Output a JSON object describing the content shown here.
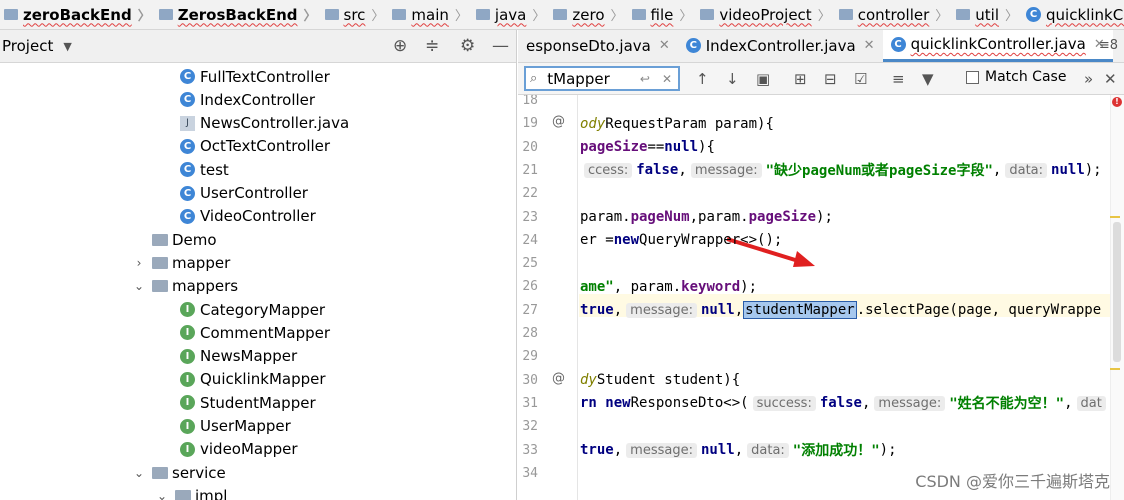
{
  "breadcrumb": [
    {
      "label": "zeroBackEnd",
      "icon": "folder-icon",
      "bold": true
    },
    {
      "label": "ZerosBackEnd",
      "icon": "folder-icon",
      "bold": true
    },
    {
      "label": "src",
      "icon": "folder-icon"
    },
    {
      "label": "main",
      "icon": "folder-icon"
    },
    {
      "label": "java",
      "icon": "folder-icon"
    },
    {
      "label": "zero",
      "icon": "folder-icon"
    },
    {
      "label": "file",
      "icon": "folder-icon"
    },
    {
      "label": "videoProject",
      "icon": "folder-icon"
    },
    {
      "label": "controller",
      "icon": "folder-icon"
    },
    {
      "label": "util",
      "icon": "folder-icon"
    },
    {
      "label": "quicklinkController",
      "icon": "class-icon"
    }
  ],
  "project": {
    "title": "Project",
    "tree": [
      {
        "label": "FullTextController",
        "icon": "class-icon",
        "indent": 2
      },
      {
        "label": "IndexController",
        "icon": "class-icon",
        "indent": 2
      },
      {
        "label": "NewsController.java",
        "icon": "java-file-icon",
        "indent": 2
      },
      {
        "label": "OctTextController",
        "icon": "class-icon",
        "indent": 2
      },
      {
        "label": "test",
        "icon": "class-icon",
        "indent": 2
      },
      {
        "label": "UserController",
        "icon": "class-icon",
        "indent": 2
      },
      {
        "label": "VideoController",
        "icon": "class-icon",
        "indent": 2
      },
      {
        "label": "Demo",
        "icon": "package-icon",
        "indent": 1,
        "arrow": ""
      },
      {
        "label": "mapper",
        "icon": "package-icon",
        "indent": 1,
        "arrow": "›"
      },
      {
        "label": "mappers",
        "icon": "package-icon",
        "indent": 1,
        "arrow": "⌄"
      },
      {
        "label": "CategoryMapper",
        "icon": "interface-icon",
        "indent": 2
      },
      {
        "label": "CommentMapper",
        "icon": "interface-icon",
        "indent": 2
      },
      {
        "label": "NewsMapper",
        "icon": "interface-icon",
        "indent": 2
      },
      {
        "label": "QuicklinkMapper",
        "icon": "interface-icon",
        "indent": 2
      },
      {
        "label": "StudentMapper",
        "icon": "interface-icon",
        "indent": 2
      },
      {
        "label": "UserMapper",
        "icon": "interface-icon",
        "indent": 2
      },
      {
        "label": "videoMapper",
        "icon": "interface-icon",
        "indent": 2
      },
      {
        "label": "service",
        "icon": "package-icon",
        "indent": 1,
        "arrow": "⌄"
      },
      {
        "label": "impl",
        "icon": "package-icon",
        "indent": 2,
        "arrow": "⌄"
      }
    ]
  },
  "tabs": [
    {
      "label": "esponseDto.java",
      "icon": "java-file-icon",
      "active": false,
      "closable": true
    },
    {
      "label": "IndexController.java",
      "icon": "class-icon",
      "active": false,
      "closable": true
    },
    {
      "label": "quicklinkController.java",
      "icon": "class-icon",
      "active": true,
      "closable": true
    }
  ],
  "tabs_more": "≡8",
  "find": {
    "value": "tMapper",
    "match_case_label": "Match Case"
  },
  "code": {
    "lines": [
      {
        "n": "18",
        "html": ""
      },
      {
        "n": "19",
        "mark": "@",
        "html": "<span class='it'>ody</span> RequestParam param){"
      },
      {
        "n": "20",
        "html": "<span class='fld'>pageSize</span>==<span class='kw'>null</span>){"
      },
      {
        "n": "21",
        "html": "<span class='hint'>ccess:</span><span class='kw'>false</span>, <span class='hint'>message:</span><span class='str'>\"缺少pageNum或者pageSize字段\"</span>, <span class='hint'>data:</span><span class='kw'>null</span>);"
      },
      {
        "n": "22",
        "html": ""
      },
      {
        "n": "23",
        "html": "param.<span class='fld'>pageNum</span>,param.<span class='fld'>pageSize</span>);"
      },
      {
        "n": "24",
        "html": "er = <span class='kw'>new</span> QueryWrapper<>();"
      },
      {
        "n": "25",
        "html": ""
      },
      {
        "n": "26",
        "html": "<span class='str'>ame\"</span>, param.<span class='fld'>keyword</span>);"
      },
      {
        "n": "27",
        "html": " <span class='kw'>true</span>, <span class='hint'>message:</span><span class='kw'>null</span>, <span class='sel'>studentMapper</span>.selectPage(page, queryWrappe"
      },
      {
        "n": "28",
        "html": ""
      },
      {
        "n": "29",
        "html": ""
      },
      {
        "n": "30",
        "mark": "@",
        "html": "<span class='it'>dy</span> Student student){"
      },
      {
        "n": "31",
        "html": "<span class='kw'>rn new</span> ResponseDto<>( <span class='hint'>success:</span><span class='kw'>false</span>, <span class='hint'>message:</span><span class='str'>\"姓名不能为空！\"</span>, <span class='hint'>dat</span>"
      },
      {
        "n": "32",
        "html": ""
      },
      {
        "n": "33",
        "html": " <span class='kw'>true</span>, <span class='hint'>message:</span><span class='kw'>null</span>, <span class='hint'>data:</span><span class='str'>\"添加成功！\"</span>);"
      },
      {
        "n": "34",
        "html": ""
      }
    ]
  },
  "watermark": "CSDN @爱你三千遍斯塔克",
  "colors": {
    "accent": "#4a88c7",
    "selection": "#a6c8ee",
    "annotation_arrow": "#e02020"
  }
}
